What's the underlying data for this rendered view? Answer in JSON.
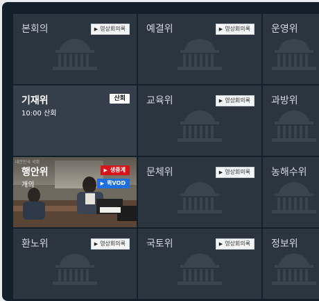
{
  "vod_label": "영상회의록",
  "committees": [
    {
      "name": "본회의"
    },
    {
      "name": "예결위"
    },
    {
      "name": "운영위"
    },
    {
      "name": "기재위",
      "time": "10:00 산회",
      "status": "산회"
    },
    {
      "name": "교육위"
    },
    {
      "name": "과방위"
    },
    {
      "name": "행안위",
      "status_text": "개의",
      "live_label": "생중계",
      "quick_label": "퀵VOD",
      "video_caption": "대한민국 국회"
    },
    {
      "name": "문체위"
    },
    {
      "name": "농해수위"
    },
    {
      "name": "환노위"
    },
    {
      "name": "국토위"
    },
    {
      "name": "정보위"
    }
  ]
}
